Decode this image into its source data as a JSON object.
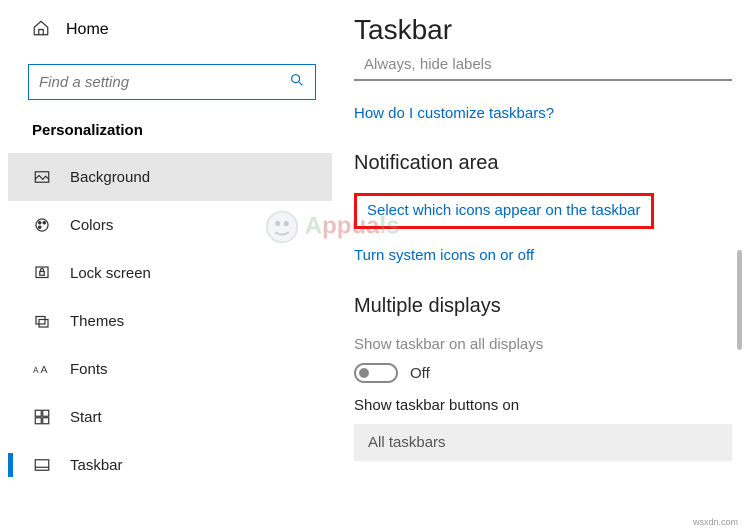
{
  "sidebar": {
    "home": "Home",
    "search_placeholder": "Find a setting",
    "category": "Personalization",
    "items": [
      {
        "label": "Background"
      },
      {
        "label": "Colors"
      },
      {
        "label": "Lock screen"
      },
      {
        "label": "Themes"
      },
      {
        "label": "Fonts"
      },
      {
        "label": "Start"
      },
      {
        "label": "Taskbar"
      }
    ]
  },
  "main": {
    "title": "Taskbar",
    "combine_value": "Always, hide labels",
    "help_link": "How do I customize taskbars?",
    "notif_heading": "Notification area",
    "link_icons": "Select which icons appear on the taskbar",
    "link_system": "Turn system icons on or off",
    "multi_heading": "Multiple displays",
    "multi_show": "Show taskbar on all displays",
    "toggle_state": "Off",
    "buttons_on": "Show taskbar buttons on",
    "buttons_value": "All taskbars"
  },
  "credit": "wsxdn.com"
}
